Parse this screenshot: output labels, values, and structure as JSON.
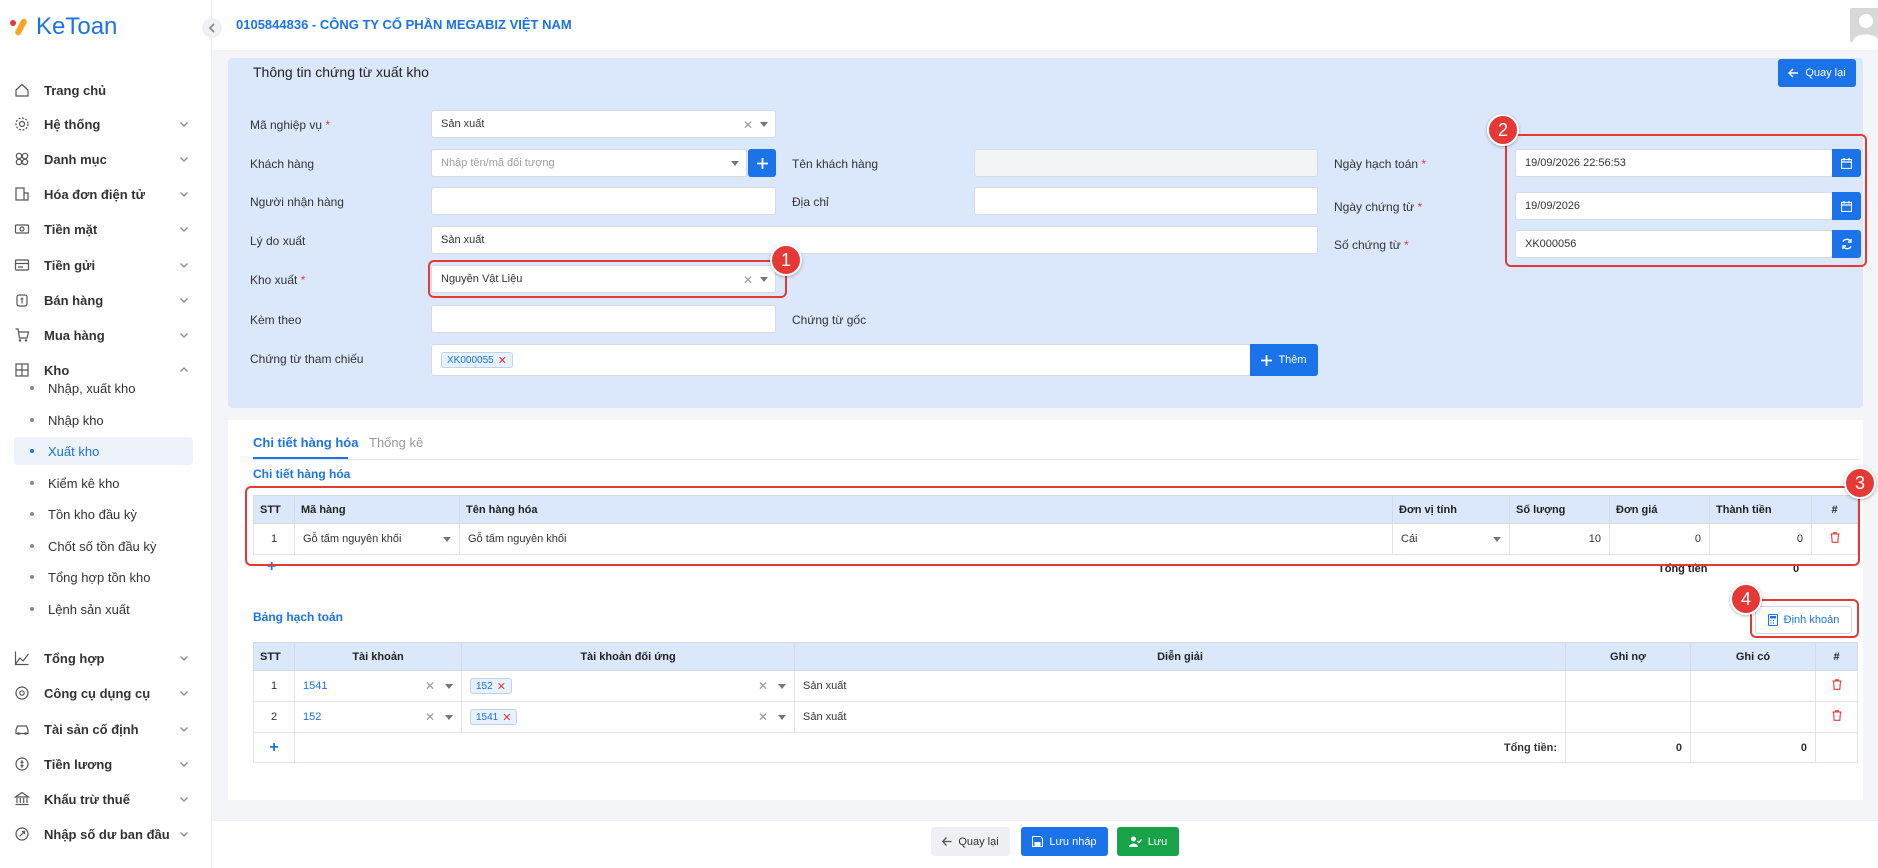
{
  "app": {
    "brand": "KeToan"
  },
  "header": {
    "company": "0105844836 - CÔNG TY CỔ PHẦN MEGABIZ VIỆT NAM"
  },
  "sidebar": {
    "items": [
      {
        "label": "Trang chủ"
      },
      {
        "label": "Hệ thống"
      },
      {
        "label": "Danh mục"
      },
      {
        "label": "Hóa đơn điện tử"
      },
      {
        "label": "Tiền mặt"
      },
      {
        "label": "Tiền gửi"
      },
      {
        "label": "Bán hàng"
      },
      {
        "label": "Mua hàng"
      },
      {
        "label": "Kho"
      },
      {
        "label": "Tổng hợp"
      },
      {
        "label": "Công cụ dụng cụ"
      },
      {
        "label": "Tài sản cố định"
      },
      {
        "label": "Tiền lương"
      },
      {
        "label": "Khấu trừ thuế"
      },
      {
        "label": "Nhập số dư ban đầu"
      }
    ],
    "kho_sub": [
      {
        "label": "Nhập, xuất kho"
      },
      {
        "label": "Nhập kho"
      },
      {
        "label": "Xuất kho"
      },
      {
        "label": "Kiểm kê kho"
      },
      {
        "label": "Tồn kho đầu kỳ"
      },
      {
        "label": "Chốt số tồn đầu kỳ"
      },
      {
        "label": "Tổng hợp tồn kho"
      },
      {
        "label": "Lệnh sản xuất"
      }
    ]
  },
  "form": {
    "title": "Thông tin chứng từ xuất kho",
    "back_label": "Quay lại",
    "ma_nghiep_vu": {
      "label": "Mã nghiệp vụ",
      "value": "Sản xuất"
    },
    "khach_hang": {
      "label": "Khách hàng",
      "placeholder": "Nhập tên/mã đối tượng"
    },
    "ten_khach_hang": {
      "label": "Tên khách hàng",
      "value": ""
    },
    "nguoi_nhan_hang": {
      "label": "Người nhận hàng",
      "value": ""
    },
    "dia_chi": {
      "label": "Địa chỉ",
      "value": ""
    },
    "ly_do_xuat": {
      "label": "Lý do xuất",
      "value": "Sản xuất"
    },
    "kho_xuat": {
      "label": "Kho xuất",
      "value": "Nguyên Vật Liệu"
    },
    "kem_theo": {
      "label": "Kèm theo",
      "value": ""
    },
    "chung_tu_goc": {
      "label": "Chứng từ gốc"
    },
    "chung_tu_tham_chieu": {
      "label": "Chứng từ tham chiếu",
      "tag": "XK000055",
      "add_label": "Thêm"
    },
    "ngay_hach_toan": {
      "label": "Ngày hạch toán",
      "value": "19/09/2026 22:56:53"
    },
    "ngay_chung_tu": {
      "label": "Ngày chứng từ",
      "value": "19/09/2026"
    },
    "so_chung_tu": {
      "label": "Số chứng từ",
      "value": "XK000056"
    }
  },
  "annotations": [
    "1",
    "2",
    "3",
    "4"
  ],
  "tabs": [
    {
      "label": "Chi tiết hàng hóa"
    },
    {
      "label": "Thống kê"
    }
  ],
  "goods": {
    "title": "Chi tiết hàng hóa",
    "headers": [
      "STT",
      "Mã hàng",
      "Tên hàng hóa",
      "Đơn vị tính",
      "Số lượng",
      "Đơn giá",
      "Thành tiền",
      "#"
    ],
    "rows": [
      {
        "stt": "1",
        "ma_hang": "Gỗ tấm nguyên khối",
        "ten_hang": "Gỗ tấm nguyên khối",
        "dvt": "Cái",
        "so_luong": "10",
        "don_gia": "0",
        "thanh_tien": "0"
      }
    ],
    "total_label": "Tổng tiền",
    "total_value": "0"
  },
  "accounting": {
    "title": "Bảng hạch toán",
    "dinh_khoan_label": "Định khoản",
    "headers": [
      "STT",
      "Tài khoản",
      "Tài khoản đối ứng",
      "Diễn giải",
      "Ghi nợ",
      "Ghi có",
      "#"
    ],
    "rows": [
      {
        "stt": "1",
        "tai_khoan": "1541",
        "doi_ung": "152",
        "dien_giai": "Sản xuất",
        "ghi_no": "",
        "ghi_co": ""
      },
      {
        "stt": "2",
        "tai_khoan": "152",
        "doi_ung": "1541",
        "dien_giai": "Sản xuất",
        "ghi_no": "",
        "ghi_co": ""
      }
    ],
    "total_label": "Tổng tiền:",
    "total_no": "0",
    "total_co": "0"
  },
  "footer": {
    "back": "Quay lại",
    "draft": "Lưu nháp",
    "save": "Lưu"
  },
  "colors": {
    "primary": "#1a73e8",
    "annotation": "#e53935",
    "success": "#16a34a",
    "form_bg": "#dbe8fb"
  }
}
